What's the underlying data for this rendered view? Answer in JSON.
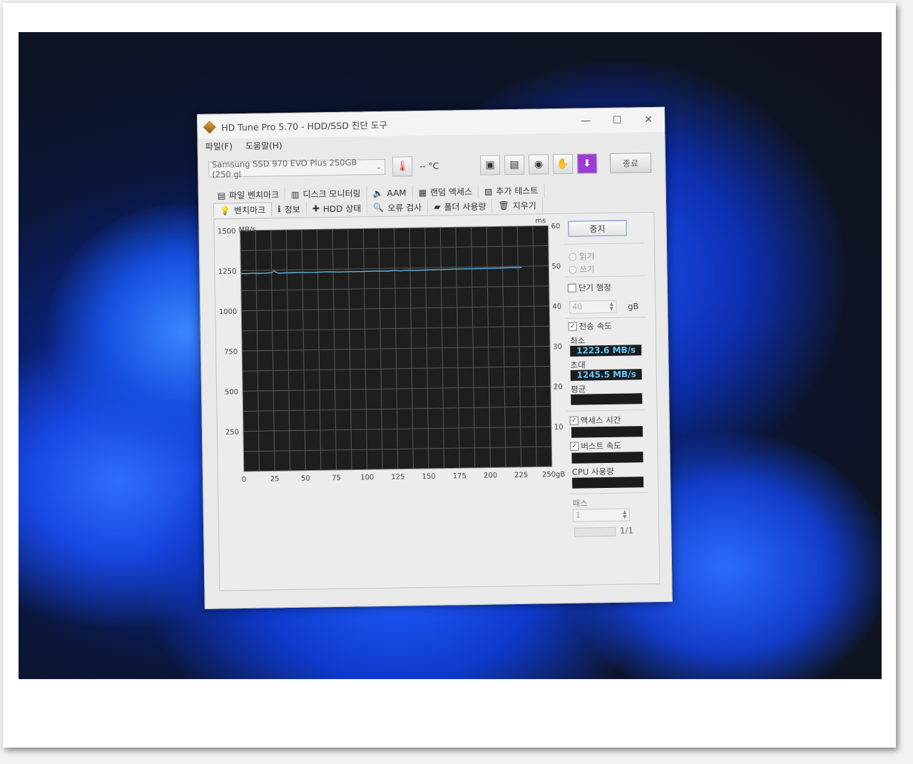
{
  "window": {
    "title": "HD Tune Pro 5.70 - HDD/SSD 진단 도구",
    "controls": {
      "minimize": "—",
      "maximize": "☐",
      "close": "✕"
    }
  },
  "menu": {
    "file": "파일(F)",
    "help": "도움말(H)"
  },
  "toolbar": {
    "drive": "Samsung SSD 970 EVO Plus 250GB (250 gl",
    "temperature": "-- °C",
    "exit": "종료"
  },
  "tabs": {
    "row1": [
      {
        "label": "파일 벤치마크",
        "icon": "file-benchmark-icon",
        "glyph": "▤"
      },
      {
        "label": "디스크 모니터링",
        "icon": "disk-monitor-icon",
        "glyph": "▥"
      },
      {
        "label": "AAM",
        "icon": "speaker-icon",
        "glyph": "🔈"
      },
      {
        "label": "랜덤 액세스",
        "icon": "random-access-icon",
        "glyph": "▦"
      },
      {
        "label": "추가 테스트",
        "icon": "extra-tests-icon",
        "glyph": "▧"
      }
    ],
    "row2": [
      {
        "label": "벤치마크",
        "icon": "lightbulb-icon",
        "glyph": "💡",
        "active": true
      },
      {
        "label": "정보",
        "icon": "info-icon",
        "glyph": "ℹ"
      },
      {
        "label": "HDD 상태",
        "icon": "health-cross-icon",
        "glyph": "✚"
      },
      {
        "label": "오류 검사",
        "icon": "magnifier-icon",
        "glyph": "🔍"
      },
      {
        "label": "폴더 사용량",
        "icon": "folder-icon",
        "glyph": "▰"
      },
      {
        "label": "지우기",
        "icon": "trash-icon",
        "glyph": "🗑"
      }
    ]
  },
  "side": {
    "stop": "중지",
    "read": "읽기",
    "write": "쓰기",
    "short_stroke": "단기 행정",
    "short_stroke_value": "40",
    "short_stroke_unit": "gB",
    "transfer_rate": "전송 속도",
    "min_label": "최소",
    "min_value": "1223.6 MB/s",
    "max_label": "초대",
    "max_value": "1245.5 MB/s",
    "avg_label": "평균",
    "avg_value": "",
    "access_time": "액세스 시간",
    "burst_rate": "버스트 속도",
    "cpu_usage": "CPU 사용량",
    "passes_label": "패스",
    "passes_value": "1",
    "pass_progress": "1/1"
  },
  "chart_data": {
    "type": "line",
    "y_left_unit": "MB/s",
    "y_right_unit": "ms",
    "ylim": [
      0,
      1500
    ],
    "ylim_right": [
      0,
      60
    ],
    "xlim": [
      0,
      250
    ],
    "x_ticks": [
      "0",
      "25",
      "50",
      "75",
      "100",
      "125",
      "150",
      "175",
      "200",
      "225",
      "250gB"
    ],
    "y_ticks_left": [
      "1500",
      "1250",
      "1000",
      "750",
      "500",
      "250"
    ],
    "y_ticks_right": [
      "60",
      "50",
      "40",
      "30",
      "20",
      "10"
    ],
    "grid": true,
    "series": [
      {
        "color": "#5fb4e6",
        "x": [
          0,
          5,
          10,
          15,
          20,
          25,
          27,
          30,
          40,
          50,
          60,
          70,
          75,
          80,
          90,
          100,
          110,
          120,
          125,
          130,
          135,
          140,
          150,
          160,
          170,
          180,
          190,
          200,
          210,
          220,
          225,
          228
        ],
        "y": [
          1232,
          1230,
          1233,
          1231,
          1232,
          1234,
          1245,
          1231,
          1232,
          1233,
          1232,
          1234,
          1233,
          1232,
          1233,
          1233,
          1234,
          1233,
          1236,
          1233,
          1236,
          1234,
          1236,
          1237,
          1238,
          1239,
          1239,
          1240,
          1241,
          1242,
          1242,
          1242
        ]
      }
    ]
  }
}
